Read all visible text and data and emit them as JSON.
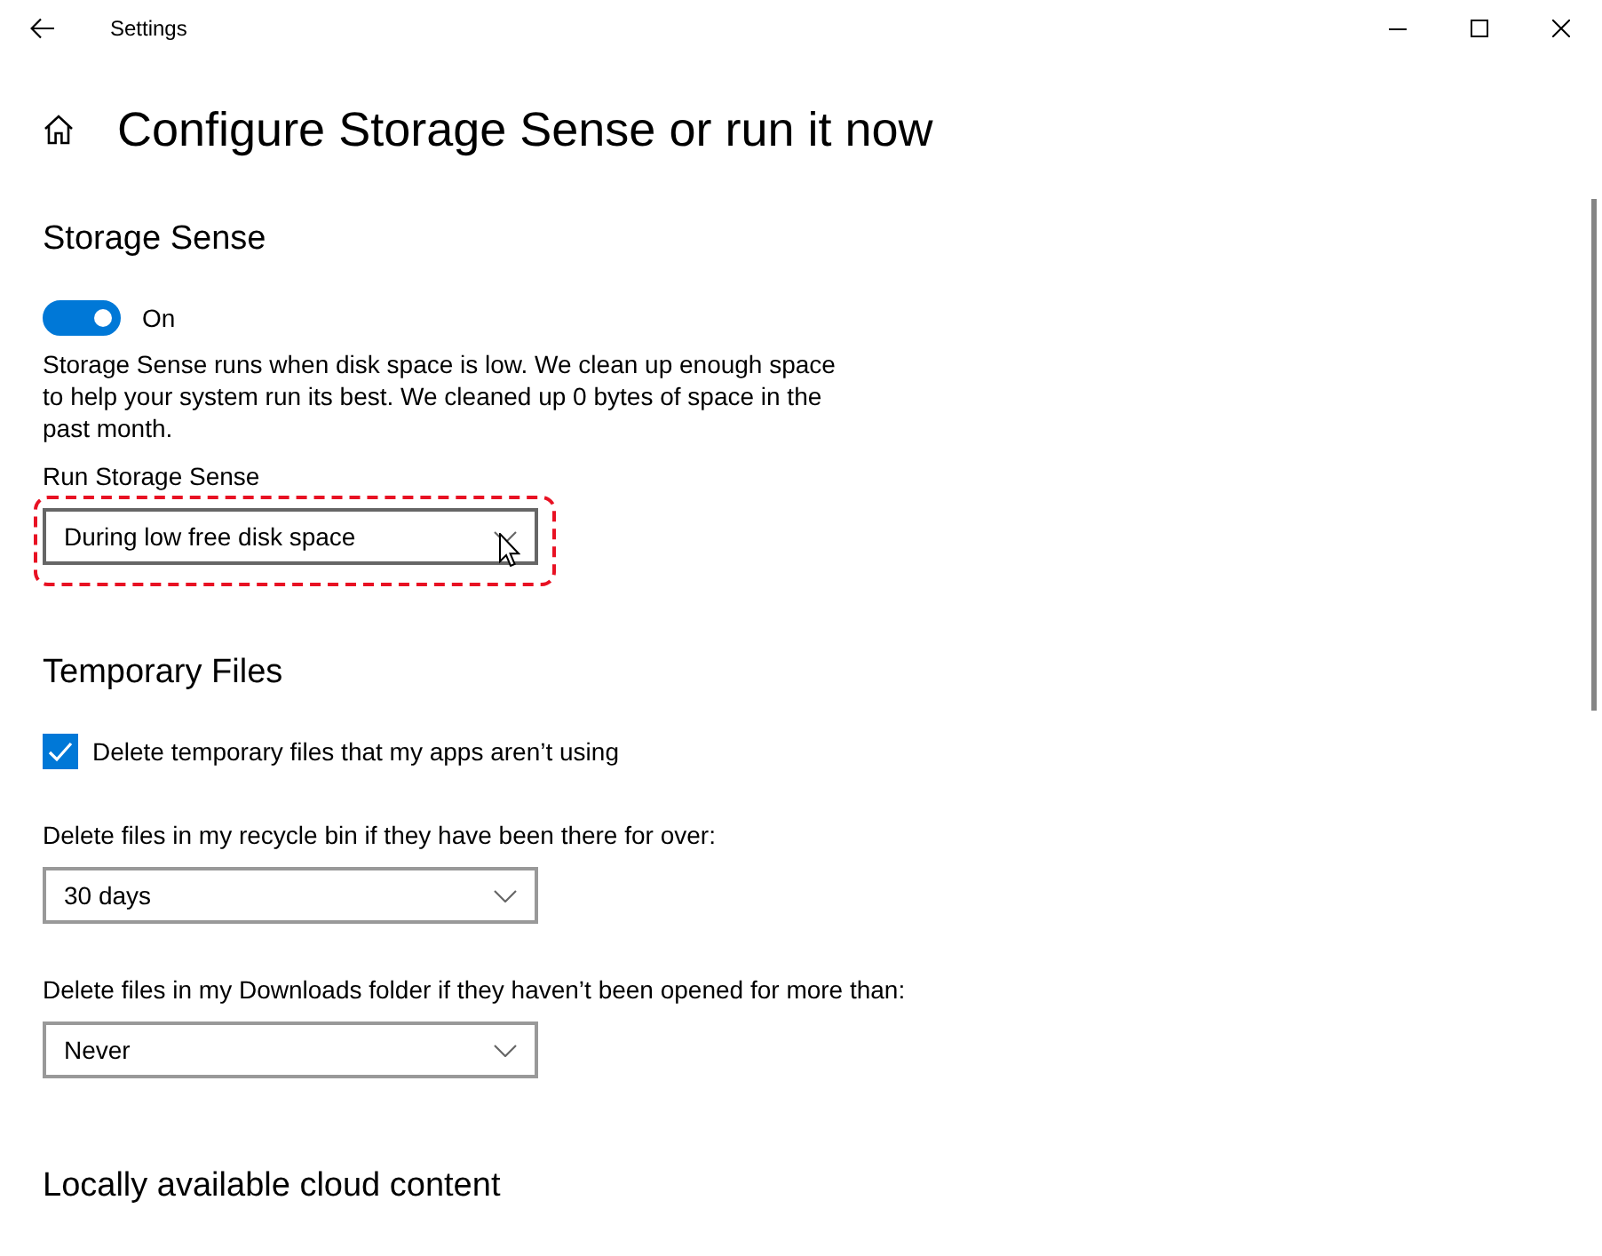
{
  "window": {
    "title": "Settings"
  },
  "page": {
    "title": "Configure Storage Sense or run it now"
  },
  "sections": [
    {
      "heading": "Storage Sense",
      "items": [
        {
          "kind": "toggle",
          "label": "On",
          "on": true
        },
        {
          "kind": "text",
          "text": "Storage Sense runs when disk space is low. We clean up enough space to help your system run its best. We cleaned up 0 bytes of space in the past month."
        },
        {
          "kind": "dropdown",
          "label": "Run Storage Sense",
          "value": "During low free disk space",
          "highlighted": true,
          "hovered": true
        }
      ]
    },
    {
      "heading": "Temporary Files",
      "items": [
        {
          "kind": "checkbox",
          "label": "Delete temporary files that my apps aren’t using",
          "checked": true
        },
        {
          "kind": "dropdown",
          "label": "Delete files in my recycle bin if they have been there for over:",
          "value": "30 days",
          "highlighted": false,
          "hovered": false
        },
        {
          "kind": "dropdown",
          "label": "Delete files in my Downloads folder if they haven’t been opened for more than:",
          "value": "Never",
          "highlighted": false,
          "hovered": false
        }
      ]
    },
    {
      "heading": "Locally available cloud content"
    }
  ]
}
